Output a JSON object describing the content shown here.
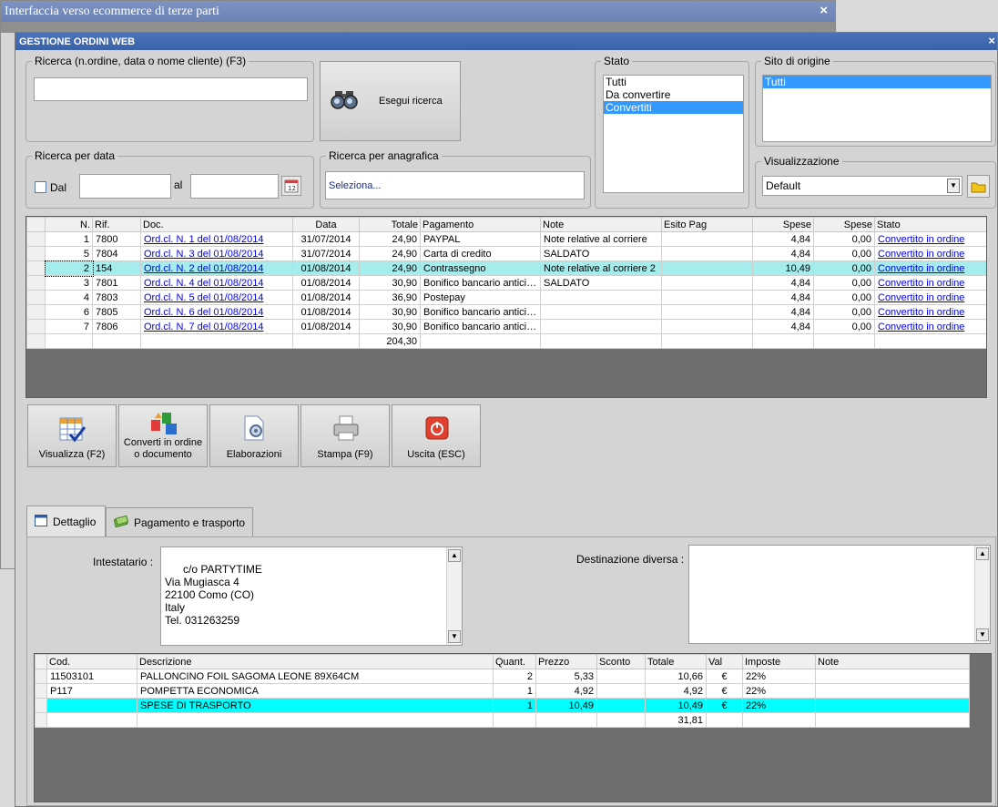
{
  "background_window": {
    "title": "Interfaccia verso ecommerce di terze parti",
    "close": "×"
  },
  "window": {
    "title": "GESTIONE ORDINI WEB",
    "close": "×"
  },
  "search": {
    "legend": "Ricerca (n.ordine, data o nome cliente) (F3)",
    "value": "",
    "button_label": "Esegui ricerca"
  },
  "date_search": {
    "legend": "Ricerca per data",
    "from_label": "Dal",
    "to_label": "al",
    "from_value": "",
    "to_value": ""
  },
  "registry_search": {
    "legend": "Ricerca per anagrafica",
    "value": "Seleziona..."
  },
  "stato": {
    "legend": "Stato",
    "options": [
      "Tutti",
      "Da convertire",
      "Convertiti"
    ],
    "selected": 2
  },
  "sito": {
    "legend": "Sito di origine",
    "options": [
      "Tutti"
    ],
    "selected": 0
  },
  "visualizzazione": {
    "legend": "Visualizzazione",
    "value": "Default"
  },
  "orders": {
    "columns": [
      "N.",
      "Rif.",
      "Doc.",
      "Data",
      "Totale",
      "Pagamento",
      "Note",
      "Esito Pag",
      "Spese",
      "Spese",
      "Stato"
    ],
    "rows": [
      [
        "1",
        "7800",
        "Ord.cl. N. 1 del 01/08/2014",
        "31/07/2014",
        "24,90",
        "PAYPAL",
        "Note relative al corriere",
        "",
        "4,84",
        "0,00",
        "Convertito in ordine"
      ],
      [
        "5",
        "7804",
        "Ord.cl. N. 3 del 01/08/2014",
        "31/07/2014",
        "24,90",
        "Carta di credito",
        "SALDATO",
        "",
        "4,84",
        "0,00",
        "Convertito in ordine"
      ],
      [
        "2",
        "154",
        "Ord.cl. N. 2 del 01/08/2014",
        "01/08/2014",
        "24,90",
        "Contrassegno",
        "Note relative al corriere 2",
        "",
        "10,49",
        "0,00",
        "Convertito in ordine"
      ],
      [
        "3",
        "7801",
        "Ord.cl. N. 4 del 01/08/2014",
        "01/08/2014",
        "30,90",
        "Bonifico bancario anticip...",
        "SALDATO",
        "",
        "4,84",
        "0,00",
        "Convertito in ordine"
      ],
      [
        "4",
        "7803",
        "Ord.cl. N. 5 del 01/08/2014",
        "01/08/2014",
        "36,90",
        "Postepay",
        "",
        "",
        "4,84",
        "0,00",
        "Convertito in ordine"
      ],
      [
        "6",
        "7805",
        "Ord.cl. N. 6 del 01/08/2014",
        "01/08/2014",
        "30,90",
        "Bonifico bancario anticip...",
        "",
        "",
        "4,84",
        "0,00",
        "Convertito in ordine"
      ],
      [
        "7",
        "7806",
        "Ord.cl. N. 7 del 01/08/2014",
        "01/08/2014",
        "30,90",
        "Bonifico bancario anticip...",
        "",
        "",
        "4,84",
        "0,00",
        "Convertito in ordine"
      ]
    ],
    "selected_row": 2,
    "total": "204,30"
  },
  "toolbar": {
    "visualizza": "Visualizza (F2)",
    "converti_1": "Converti in ordine",
    "converti_2": "o documento",
    "elaborazioni": "Elaborazioni",
    "stampa": "Stampa (F9)",
    "uscita": "Uscita (ESC)"
  },
  "tabs": {
    "dettaglio": "Dettaglio",
    "pagamento": "Pagamento e trasporto"
  },
  "detail": {
    "intestatario_label": "Intestatario :",
    "intestatario_value": "c/o PARTYTIME\nVia Mugiasca 4\n22100 Como (CO)\nItaly\nTel. 031263259",
    "destinazione_label": "Destinazione diversa :",
    "destinazione_value": ""
  },
  "lines": {
    "columns": [
      "Cod.",
      "Descrizione",
      "Quant.",
      "Prezzo",
      "Sconto",
      "Totale",
      "Val",
      "Imposte",
      "Note"
    ],
    "rows": [
      [
        "11503101",
        "PALLONCINO FOIL SAGOMA LEONE 89X64CM",
        "2",
        "5,33",
        "",
        "10,66",
        "€",
        "22%",
        ""
      ],
      [
        "P117",
        "POMPETTA ECONOMICA",
        "1",
        "4,92",
        "",
        "4,92",
        "€",
        "22%",
        ""
      ],
      [
        "",
        "SPESE DI TRASPORTO",
        "1",
        "10,49",
        "",
        "10,49",
        "€",
        "22%",
        ""
      ]
    ],
    "highlight_row": 2,
    "total": "31,81"
  },
  "colors": {
    "title_bar": "#3a62a8",
    "selection": "#3399ff",
    "row_highlight": "#a5ecec",
    "line_highlight": "#00ffff",
    "link": "#0000ee"
  }
}
